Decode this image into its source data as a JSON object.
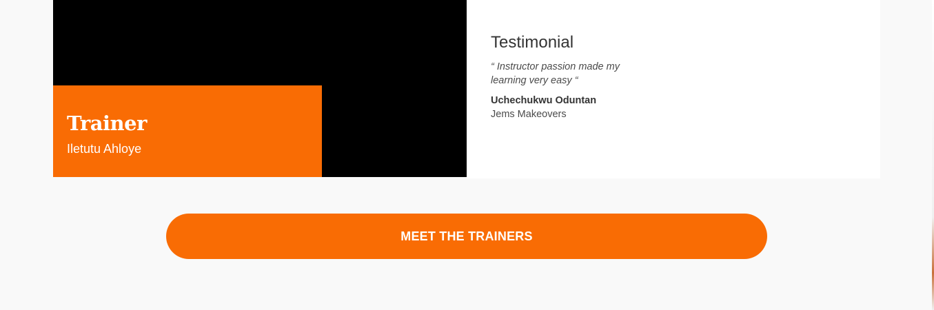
{
  "trainer": {
    "title": "Trainer",
    "name": "Iletutu Ahloye"
  },
  "testimonial": {
    "heading": "Testimonial",
    "quote": "“ Instructor passion made my learning very easy “",
    "author": "Uchechukwu Oduntan",
    "company": "Jems Makeovers"
  },
  "cta": {
    "label": "MEET THE TRAINERS"
  },
  "colors": {
    "accent": "#f96c04",
    "media_background": "#000000",
    "page_background": "#f9f9f9",
    "card_background": "#ffffff"
  }
}
